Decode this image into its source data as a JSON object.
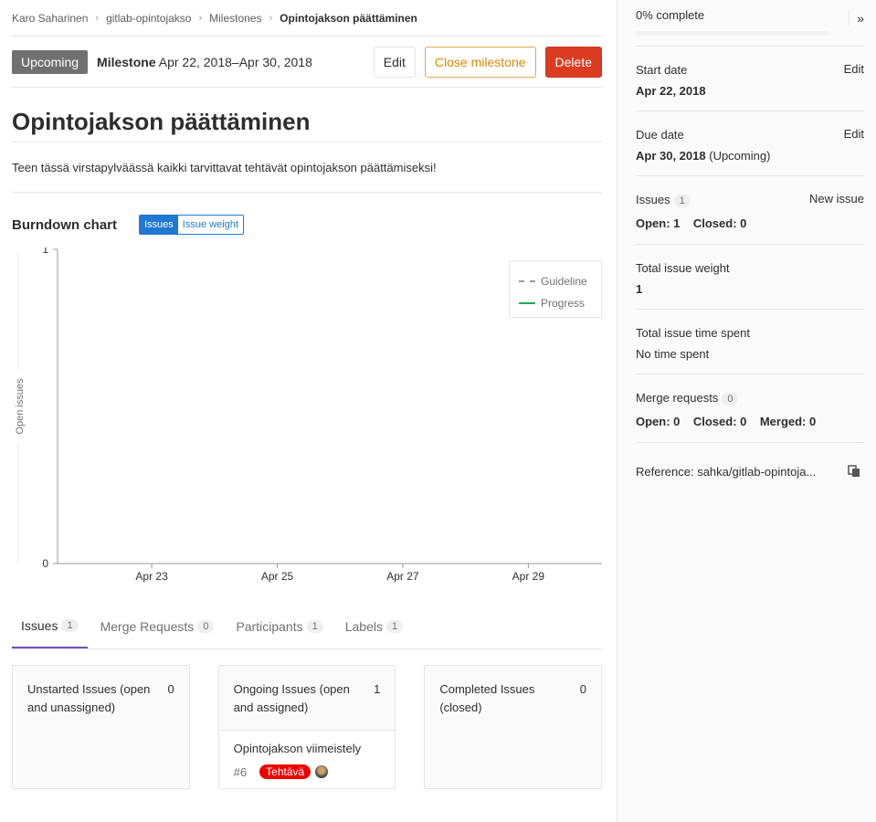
{
  "breadcrumb": {
    "items": [
      "Karo Saharinen",
      "gitlab-opintojakso",
      "Milestones"
    ],
    "current": "Opintojakson päättäminen"
  },
  "header": {
    "status": "Upcoming",
    "milestone_label": "Milestone",
    "dates": "Apr 22, 2018–Apr 30, 2018",
    "edit": "Edit",
    "close": "Close milestone",
    "delete": "Delete"
  },
  "title": "Opintojakson päättäminen",
  "description": "Teen tässä virstapylväässä kaikki tarvittavat tehtävät opintojakson päättämiseksi!",
  "burndown": {
    "heading": "Burndown chart",
    "toggle_issues": "Issues",
    "toggle_weight": "Issue weight",
    "legend_guideline": "Guideline",
    "legend_progress": "Progress"
  },
  "chart_data": {
    "type": "line",
    "ylabel": "Open issues",
    "xlabel": "",
    "ylim": [
      0,
      1
    ],
    "y_ticks": [
      "0",
      "1"
    ],
    "x_ticks": [
      "Apr 23",
      "Apr 25",
      "Apr 27",
      "Apr 29"
    ],
    "legend": [
      "Guideline",
      "Progress"
    ],
    "legend_position": "top-right",
    "series": []
  },
  "tabs": [
    {
      "label": "Issues",
      "count": "1"
    },
    {
      "label": "Merge Requests",
      "count": "0"
    },
    {
      "label": "Participants",
      "count": "1"
    },
    {
      "label": "Labels",
      "count": "1"
    }
  ],
  "cards": {
    "unstarted": {
      "title": "Unstarted Issues (open and unassigned)",
      "count": "0"
    },
    "ongoing": {
      "title": "Ongoing Issues (open and assigned)",
      "count": "1"
    },
    "completed": {
      "title": "Completed Issues (closed)",
      "count": "0"
    }
  },
  "issue": {
    "title": "Opintojakson viimeistely",
    "number": "#6",
    "label": "Tehtävä",
    "label_color": "#ee0000"
  },
  "sidebar": {
    "progress": "0% complete",
    "progress_value": 0,
    "start_label": "Start date",
    "start_value": "Apr 22, 2018",
    "due_label": "Due date",
    "due_value": "Apr 30, 2018",
    "due_status": "(Upcoming)",
    "edit": "Edit",
    "issues_label": "Issues",
    "issues_count": "1",
    "new_issue": "New issue",
    "issues_open": "Open: 1",
    "issues_closed": "Closed: 0",
    "weight_label": "Total issue weight",
    "weight_value": "1",
    "time_label": "Total issue time spent",
    "time_value": "No time spent",
    "mr_label": "Merge requests",
    "mr_count": "0",
    "mr_open": "Open: 0",
    "mr_closed": "Closed: 0",
    "mr_merged": "Merged: 0",
    "reference": "Reference: sahka/gitlab-opintoja..."
  }
}
